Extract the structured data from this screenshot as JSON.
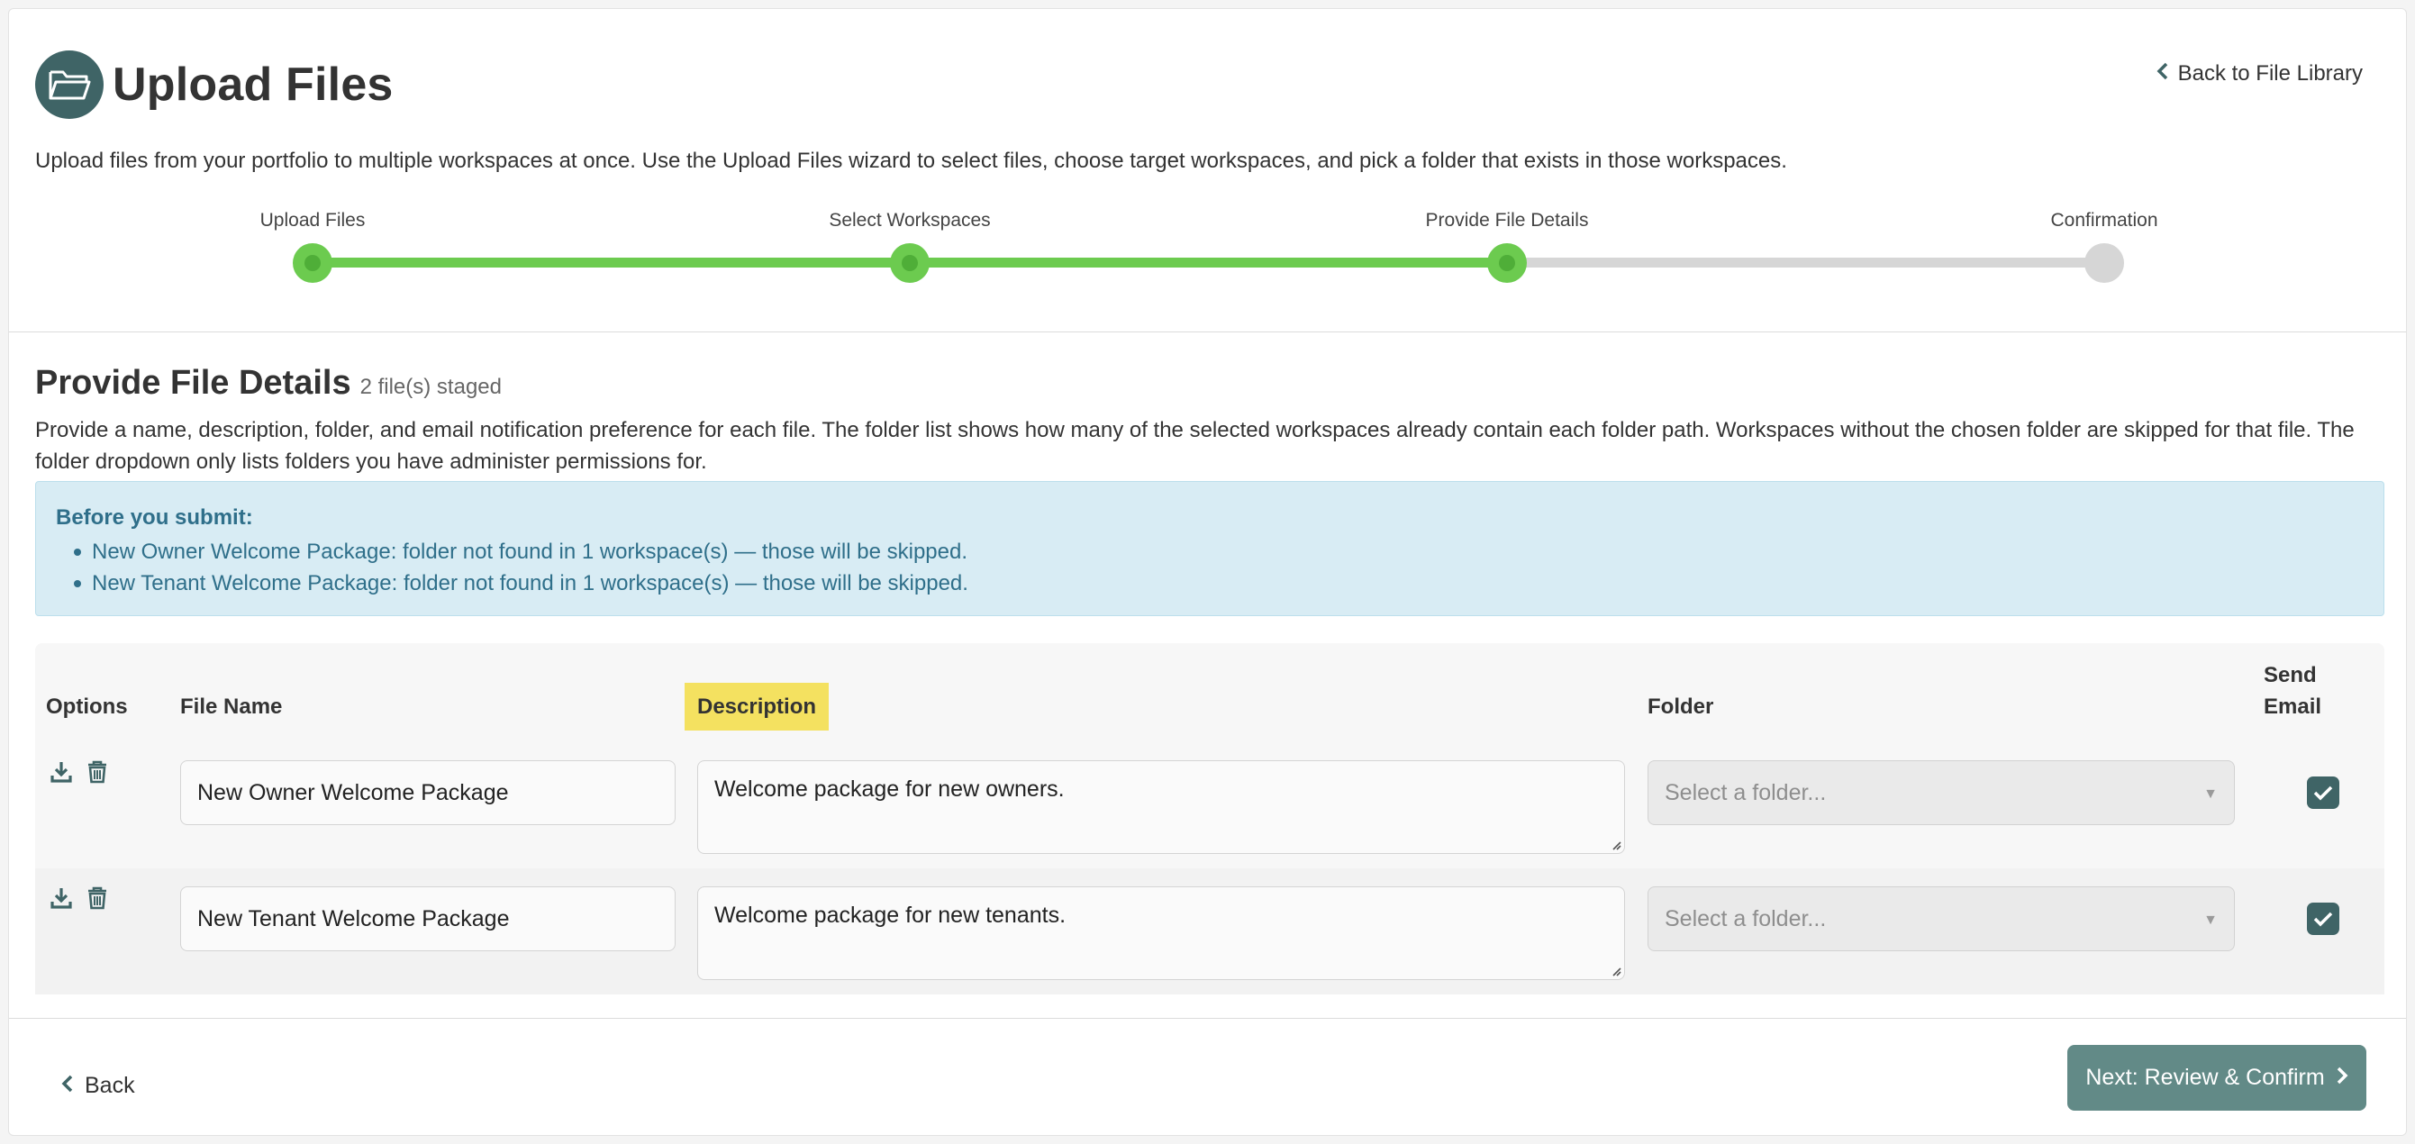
{
  "header": {
    "title": "Upload Files",
    "icon": "folder-open-icon",
    "back_link": "Back to File Library",
    "intro": "Upload files from your portfolio to multiple workspaces at once. Use the Upload Files wizard to select files, choose target workspaces, and pick a folder that exists in those workspaces."
  },
  "stepper": {
    "steps": [
      {
        "label": "Upload Files",
        "state": "complete"
      },
      {
        "label": "Select Workspaces",
        "state": "complete"
      },
      {
        "label": "Provide File Details",
        "state": "current"
      },
      {
        "label": "Confirmation",
        "state": "pending"
      }
    ],
    "colors": {
      "active": "#6ccb4f",
      "inactive": "#d6d6d6"
    }
  },
  "section": {
    "title": "Provide File Details",
    "staged": "2 file(s) staged",
    "description": "Provide a name, description, folder, and email notification preference for each file. The folder list shows how many of the selected workspaces already contain each folder path. Workspaces without the chosen folder are skipped for that file. The folder dropdown only lists folders you have administer permissions for."
  },
  "alert": {
    "title": "Before you submit:",
    "items": [
      "New Owner Welcome Package: folder not found in 1 workspace(s) — those will be skipped.",
      "New Tenant Welcome Package: folder not found in 1 workspace(s) — those will be skipped."
    ]
  },
  "table": {
    "columns": {
      "options": "Options",
      "file_name": "File Name",
      "description": "Description",
      "folder": "Folder",
      "send_email_1": "Send",
      "send_email_2": "Email"
    },
    "rows": [
      {
        "file_name": "New Owner Welcome Package",
        "description": "Welcome package for new owners.",
        "folder_placeholder": "Select a folder...",
        "send_email": true
      },
      {
        "file_name": "New Tenant Welcome Package",
        "description": "Welcome package for new tenants.",
        "folder_placeholder": "Select a folder...",
        "send_email": true
      }
    ]
  },
  "footer": {
    "back_label": "Back",
    "next_label": "Next: Review & Confirm"
  },
  "colors": {
    "brand": "#3f6466",
    "primary_button": "#628a87",
    "highlight": "#f4e160",
    "alert_bg": "#d8ecf4",
    "alert_text": "#2f6f8a"
  }
}
